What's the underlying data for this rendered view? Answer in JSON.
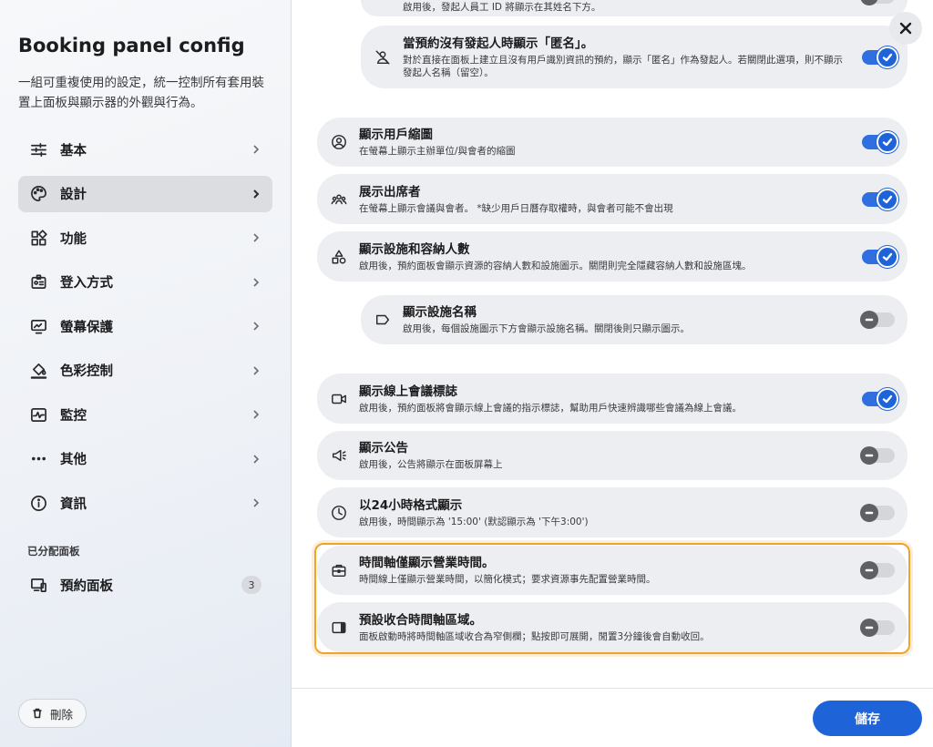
{
  "sidebar": {
    "title": "Booking panel config",
    "description": "一組可重複使用的設定，統一控制所有套用裝置上面板與顯示器的外觀與行為。",
    "items": [
      {
        "label": "基本",
        "icon": "sliders-icon"
      },
      {
        "label": "設計",
        "icon": "palette-icon",
        "active": true
      },
      {
        "label": "功能",
        "icon": "apps-icon"
      },
      {
        "label": "登入方式",
        "icon": "badge-icon"
      },
      {
        "label": "螢幕保護",
        "icon": "monitor-icon"
      },
      {
        "label": "色彩控制",
        "icon": "paint-bucket-icon"
      },
      {
        "label": "監控",
        "icon": "pulse-icon"
      },
      {
        "label": "其他",
        "icon": "more-icon"
      },
      {
        "label": "資訊",
        "icon": "info-icon"
      }
    ],
    "assigned_section": "已分配面板",
    "assigned_items": [
      {
        "label": "預約面板",
        "icon": "devices-icon",
        "count": "3"
      }
    ],
    "delete_label": "刪除"
  },
  "settings": [
    {
      "title": "",
      "desc": "啟用後，發起人員工 ID 將顯示在其姓名下方。",
      "icon": "id-icon",
      "enabled": false,
      "sub": true,
      "partial": true
    },
    {
      "title": "當預約沒有發起人時顯示「匿名」。",
      "desc": "對於直接在面板上建立且沒有用戶識別資訊的預約，顯示「匿名」作為發起人。若關閉此選項，則不顯示發起人名稱（留空）。",
      "icon": "user-off-icon",
      "enabled": true,
      "sub": true
    },
    {
      "title": "顯示用戶縮圖",
      "desc": "在螢幕上顯示主辦單位/與會者的縮圖",
      "icon": "user-circle-icon",
      "enabled": true
    },
    {
      "title": "展示出席者",
      "desc": "在螢幕上顯示會議與會者。 *缺少用戶日曆存取權時，與會者可能不會出現",
      "icon": "group-icon",
      "enabled": true
    },
    {
      "title": "顯示設施和容納人數",
      "desc": "啟用後，預約面板會顯示資源的容納人數和設施圖示。關閉則完全隱藏容納人數和設施區塊。",
      "icon": "shapes-icon",
      "enabled": true
    },
    {
      "title": "顯示設施名稱",
      "desc": "啟用後，每個設施圖示下方會顯示設施名稱。關閉後則只顯示圖示。",
      "icon": "tag-icon",
      "enabled": false,
      "sub": true
    },
    {
      "title": "顯示線上會議標誌",
      "desc": "啟用後，預約面板將會顯示線上會議的指示標誌，幫助用戶快速辨識哪些會議為線上會議。",
      "icon": "video-icon",
      "enabled": true
    },
    {
      "title": "顯示公告",
      "desc": "啟用後，公告將顯示在面板屏幕上",
      "icon": "megaphone-icon",
      "enabled": false
    },
    {
      "title": "以24小時格式顯示",
      "desc": "啟用後，時間顯示為 '15:00' (默認顯示為 '下午3:00')",
      "icon": "clock-icon",
      "enabled": false
    },
    {
      "title": "時間軸僅顯示營業時間。",
      "desc": "時間線上僅顯示營業時間，以簡化模式；要求資源事先配置營業時間。",
      "icon": "briefcase-icon",
      "enabled": false
    },
    {
      "title": "預設收合時間軸區域。",
      "desc": "面板啟動時將時間軸區域收合為窄側欄；點按即可展開，閒置3分鐘後會自動收回。",
      "icon": "panel-collapse-icon",
      "enabled": false
    }
  ],
  "footer": {
    "save_label": "儲存"
  },
  "colors": {
    "accent": "#1f63d9",
    "highlight": "#f0a32a"
  }
}
